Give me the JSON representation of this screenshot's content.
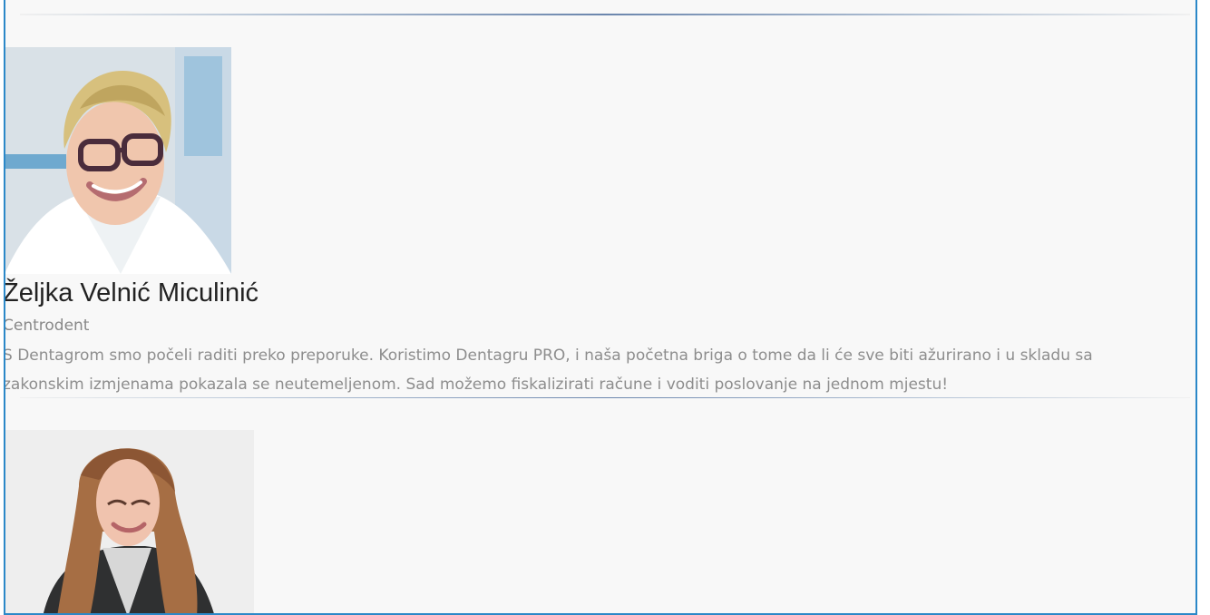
{
  "testimonials": [
    {
      "name": "Željka Velnić Miculinić",
      "company": "Centrodent",
      "quote": "S Dentagrom smo počeli raditi preko preporuke. Koristimo Dentagru PRO, i naša početna briga o tome da li će sve biti ažurirano i u skladu sa zakonskim izmjenama pokazala se neutemeljenom. Sad možemo fiskalizirati račune i voditi poslovanje na jednom mjestu!",
      "photo_icon": "portrait-photo"
    },
    {
      "photo_icon": "portrait-photo"
    }
  ],
  "colors": {
    "frame_border": "#2b88c8",
    "divider": "#6b86ad",
    "name_text": "#222222",
    "muted_text": "#8d8d8d"
  }
}
